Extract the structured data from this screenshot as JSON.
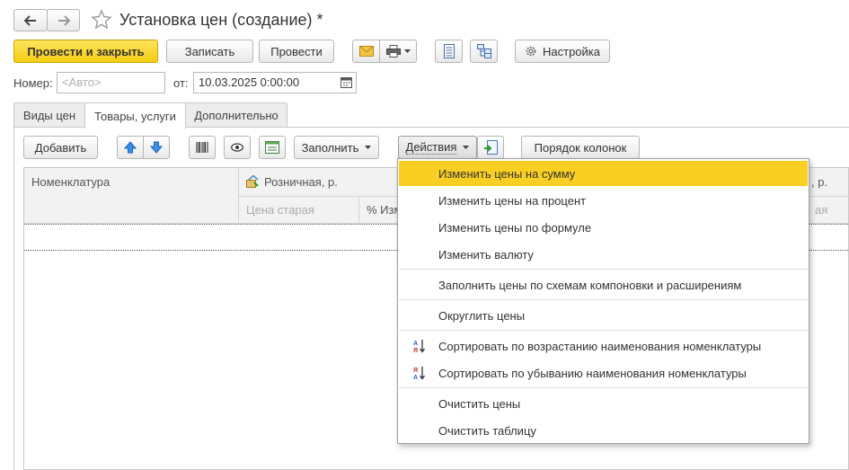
{
  "window": {
    "title": "Установка цен (создание) *"
  },
  "nav": {
    "back_icon": "arrow-left-icon",
    "forward_icon": "arrow-right-icon",
    "favorite_icon": "star-icon"
  },
  "toolbar": {
    "post_close": "Провести и закрыть",
    "save": "Записать",
    "post": "Провести",
    "settings": "Настройка"
  },
  "header": {
    "number_label": "Номер:",
    "number_placeholder": "<Авто>",
    "date_label": "от:",
    "date_value": "10.03.2025  0:00:00"
  },
  "tabs": [
    {
      "label": "Виды цен"
    },
    {
      "label": "Товары, услуги"
    },
    {
      "label": "Дополнительно"
    }
  ],
  "table_toolbar": {
    "add": "Добавить",
    "fill": "Заполнить",
    "actions": "Действия",
    "column_order": "Порядок колонок"
  },
  "table": {
    "columns": {
      "nomenclature": "Номенклатура",
      "retail": "Розничная, р.",
      "old_price": "Цена старая",
      "percent_change": "% Изм",
      "right_fragment": ", р.",
      "right_sub_fragment": "ая"
    }
  },
  "actions_menu": {
    "items": [
      {
        "label": "Изменить цены на сумму"
      },
      {
        "label": "Изменить цены на процент"
      },
      {
        "label": "Изменить цены по формуле"
      },
      {
        "label": "Изменить валюту"
      },
      {
        "label": "Заполнить цены по схемам компоновки и расширениям"
      },
      {
        "label": "Округлить цены"
      },
      {
        "label": "Сортировать по возрастанию наименования номенклатуры"
      },
      {
        "label": "Сортировать по убыванию наименования номенклатуры"
      },
      {
        "label": "Очистить цены"
      },
      {
        "label": "Очистить таблицу"
      }
    ]
  },
  "colors": {
    "accent": "#f5cd12",
    "highlight": "#f9cf24",
    "arrow_blue": "#3a8ee6"
  }
}
